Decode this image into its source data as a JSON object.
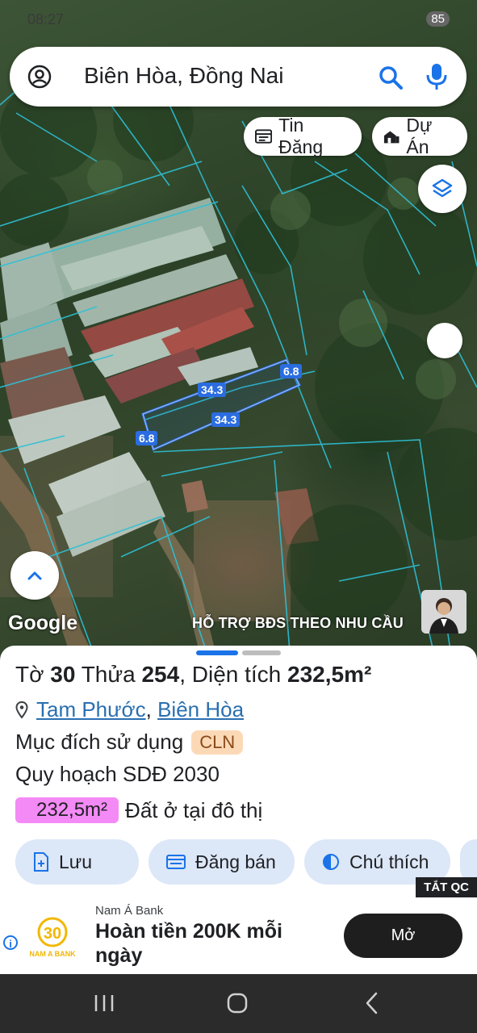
{
  "status": {
    "time": "08:27",
    "battery": "85"
  },
  "search": {
    "query": "Biên Hòa, Đồng Nai"
  },
  "map": {
    "btn_listings": "Tin Đăng",
    "btn_projects": "Dự Án",
    "edge_labels": [
      "6.8",
      "34.3",
      "34.3",
      "6.8"
    ],
    "watermark": "Google",
    "support_text": "HỖ TRỢ BĐS  THEO NHU CẦU"
  },
  "parcel": {
    "to_label": "Tờ",
    "to_value": "30",
    "thua_label": "Thửa",
    "thua_value": "254",
    "area_label": ", Diện tích",
    "area_value": "232,5m²",
    "ward": "Tam Phước",
    "sep": ",",
    "city": "Biên Hòa",
    "purpose_label": "Mục đích sử dụng",
    "purpose_code": "CLN",
    "plan_label": "Quy hoạch SDĐ 2030",
    "plan_area": "232,5m²",
    "plan_type": "Đất ở tại đô thị",
    "plan_color": "#f48af5"
  },
  "actions": {
    "save": "Lưu",
    "post": "Đăng bán",
    "legend": "Chú thích"
  },
  "ad": {
    "hide": "TẮT QC",
    "brand": "Nam Á Bank",
    "headline": "Hoàn tiền 200K mỗi ngày",
    "cta": "Mở",
    "logo_text": "NAM A BANK",
    "logo_number": "30"
  },
  "colors": {
    "parcel_line": "#2b6de0",
    "boundary": "#2ec0d6",
    "accent": "#1a73e8"
  }
}
